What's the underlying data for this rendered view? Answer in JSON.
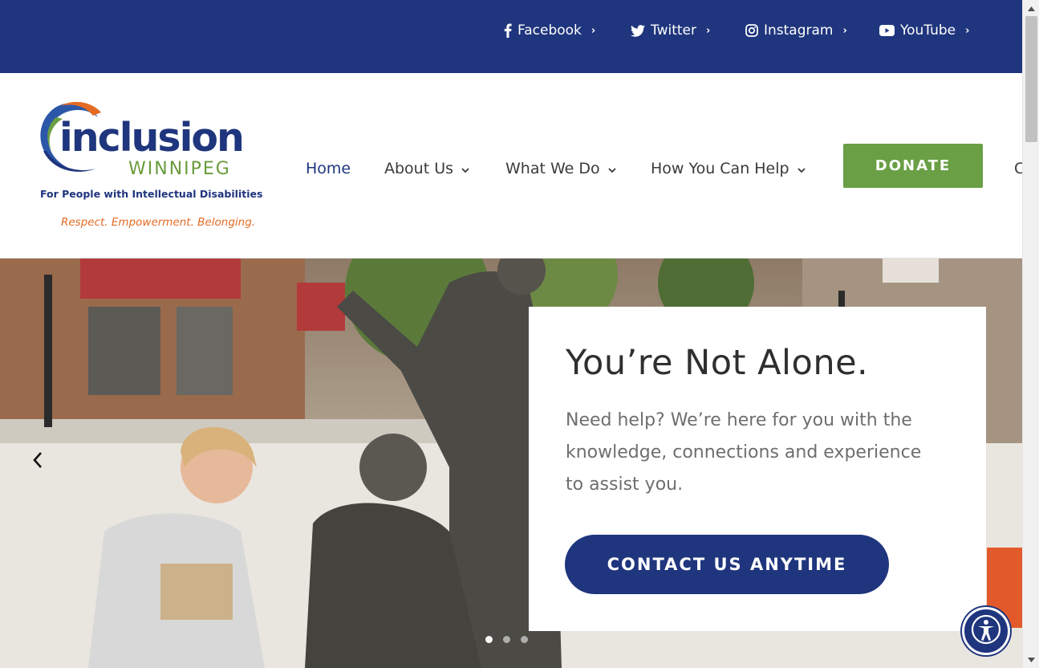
{
  "social": [
    {
      "label": "Facebook",
      "icon": "facebook-icon"
    },
    {
      "label": "Twitter",
      "icon": "twitter-icon"
    },
    {
      "label": "Instagram",
      "icon": "instagram-icon"
    },
    {
      "label": "YouTube",
      "icon": "youtube-icon"
    }
  ],
  "logo": {
    "word": "inclusion",
    "city": "WINNIPEG",
    "subtitle": "For People with Intellectual Disabilities",
    "tagline": "Respect. Empowerment. Belonging."
  },
  "nav": {
    "items": [
      {
        "label": "Home",
        "active": true
      },
      {
        "label": "About Us"
      },
      {
        "label": "What We Do"
      },
      {
        "label": "How You Can Help"
      }
    ],
    "donate_label": "DONATE",
    "cut_label": "C"
  },
  "hero": {
    "title": "You’re Not Alone.",
    "text": "Need help? We’re here for you with the knowledge, connections and experience to assist you.",
    "cta_label": "CONTACT US ANYTIME",
    "slides": 3,
    "active_slide": 1
  },
  "colors": {
    "brand_blue": "#1f357d",
    "brand_green": "#6a9f45",
    "brand_orange": "#e46b24"
  }
}
